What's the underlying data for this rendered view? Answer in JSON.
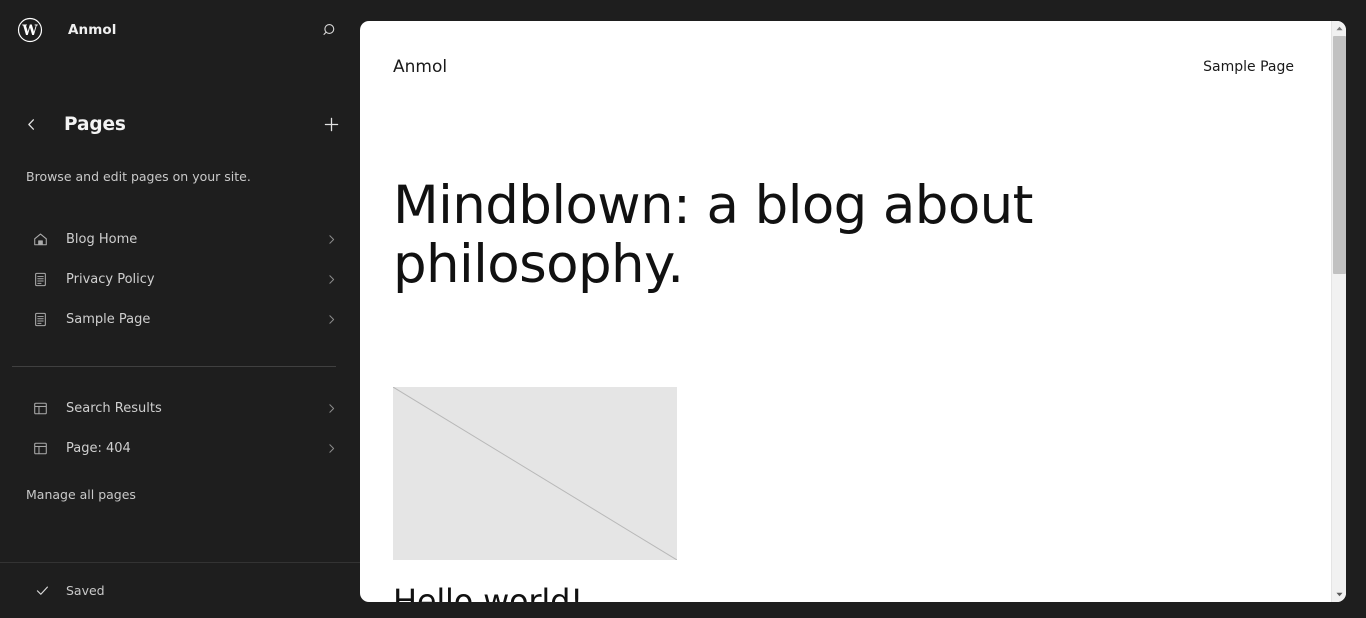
{
  "app": {
    "name": "WordPress Site Editor",
    "background_color": "#1e1e1e"
  },
  "sidebar": {
    "logo_icon": "wordpress-logo-icon",
    "site_title": "Anmol",
    "search_icon": "search-icon",
    "back_icon": "chevron-left-icon",
    "add_icon": "plus-icon",
    "panel_title": "Pages",
    "panel_description": "Browse and edit pages on your site.",
    "primary_items": [
      {
        "label": "Blog Home",
        "icon": "home-icon",
        "chevron": "chevron-right-icon"
      },
      {
        "label": "Privacy Policy",
        "icon": "page-document-icon",
        "chevron": "chevron-right-icon"
      },
      {
        "label": "Sample Page",
        "icon": "page-document-icon",
        "chevron": "chevron-right-icon"
      }
    ],
    "secondary_items": [
      {
        "label": "Search Results",
        "icon": "template-layout-icon",
        "chevron": "chevron-right-icon"
      },
      {
        "label": "Page: 404",
        "icon": "template-layout-icon",
        "chevron": "chevron-right-icon"
      }
    ],
    "manage_all_label": "Manage all pages",
    "status": {
      "icon": "checkmark-icon",
      "label": "Saved"
    }
  },
  "preview": {
    "site_brand": "Anmol",
    "nav_links": [
      {
        "label": "Sample Page"
      }
    ],
    "hero_title": "Mindblown: a blog about philosophy.",
    "post": {
      "thumbnail_alt": "placeholder-image",
      "title": "Hello world!"
    },
    "scrollbar": {
      "up_icon": "scroll-up-arrow-icon",
      "down_icon": "scroll-down-arrow-icon"
    }
  },
  "colors": {
    "sidebar_bg": "#1e1e1e",
    "sidebar_text": "#cfcfcf",
    "canvas_bg": "#ffffff",
    "placeholder_fill": "#e5e5e5",
    "divider": "#404040",
    "scrollbar_thumb": "#c1c1c1"
  }
}
